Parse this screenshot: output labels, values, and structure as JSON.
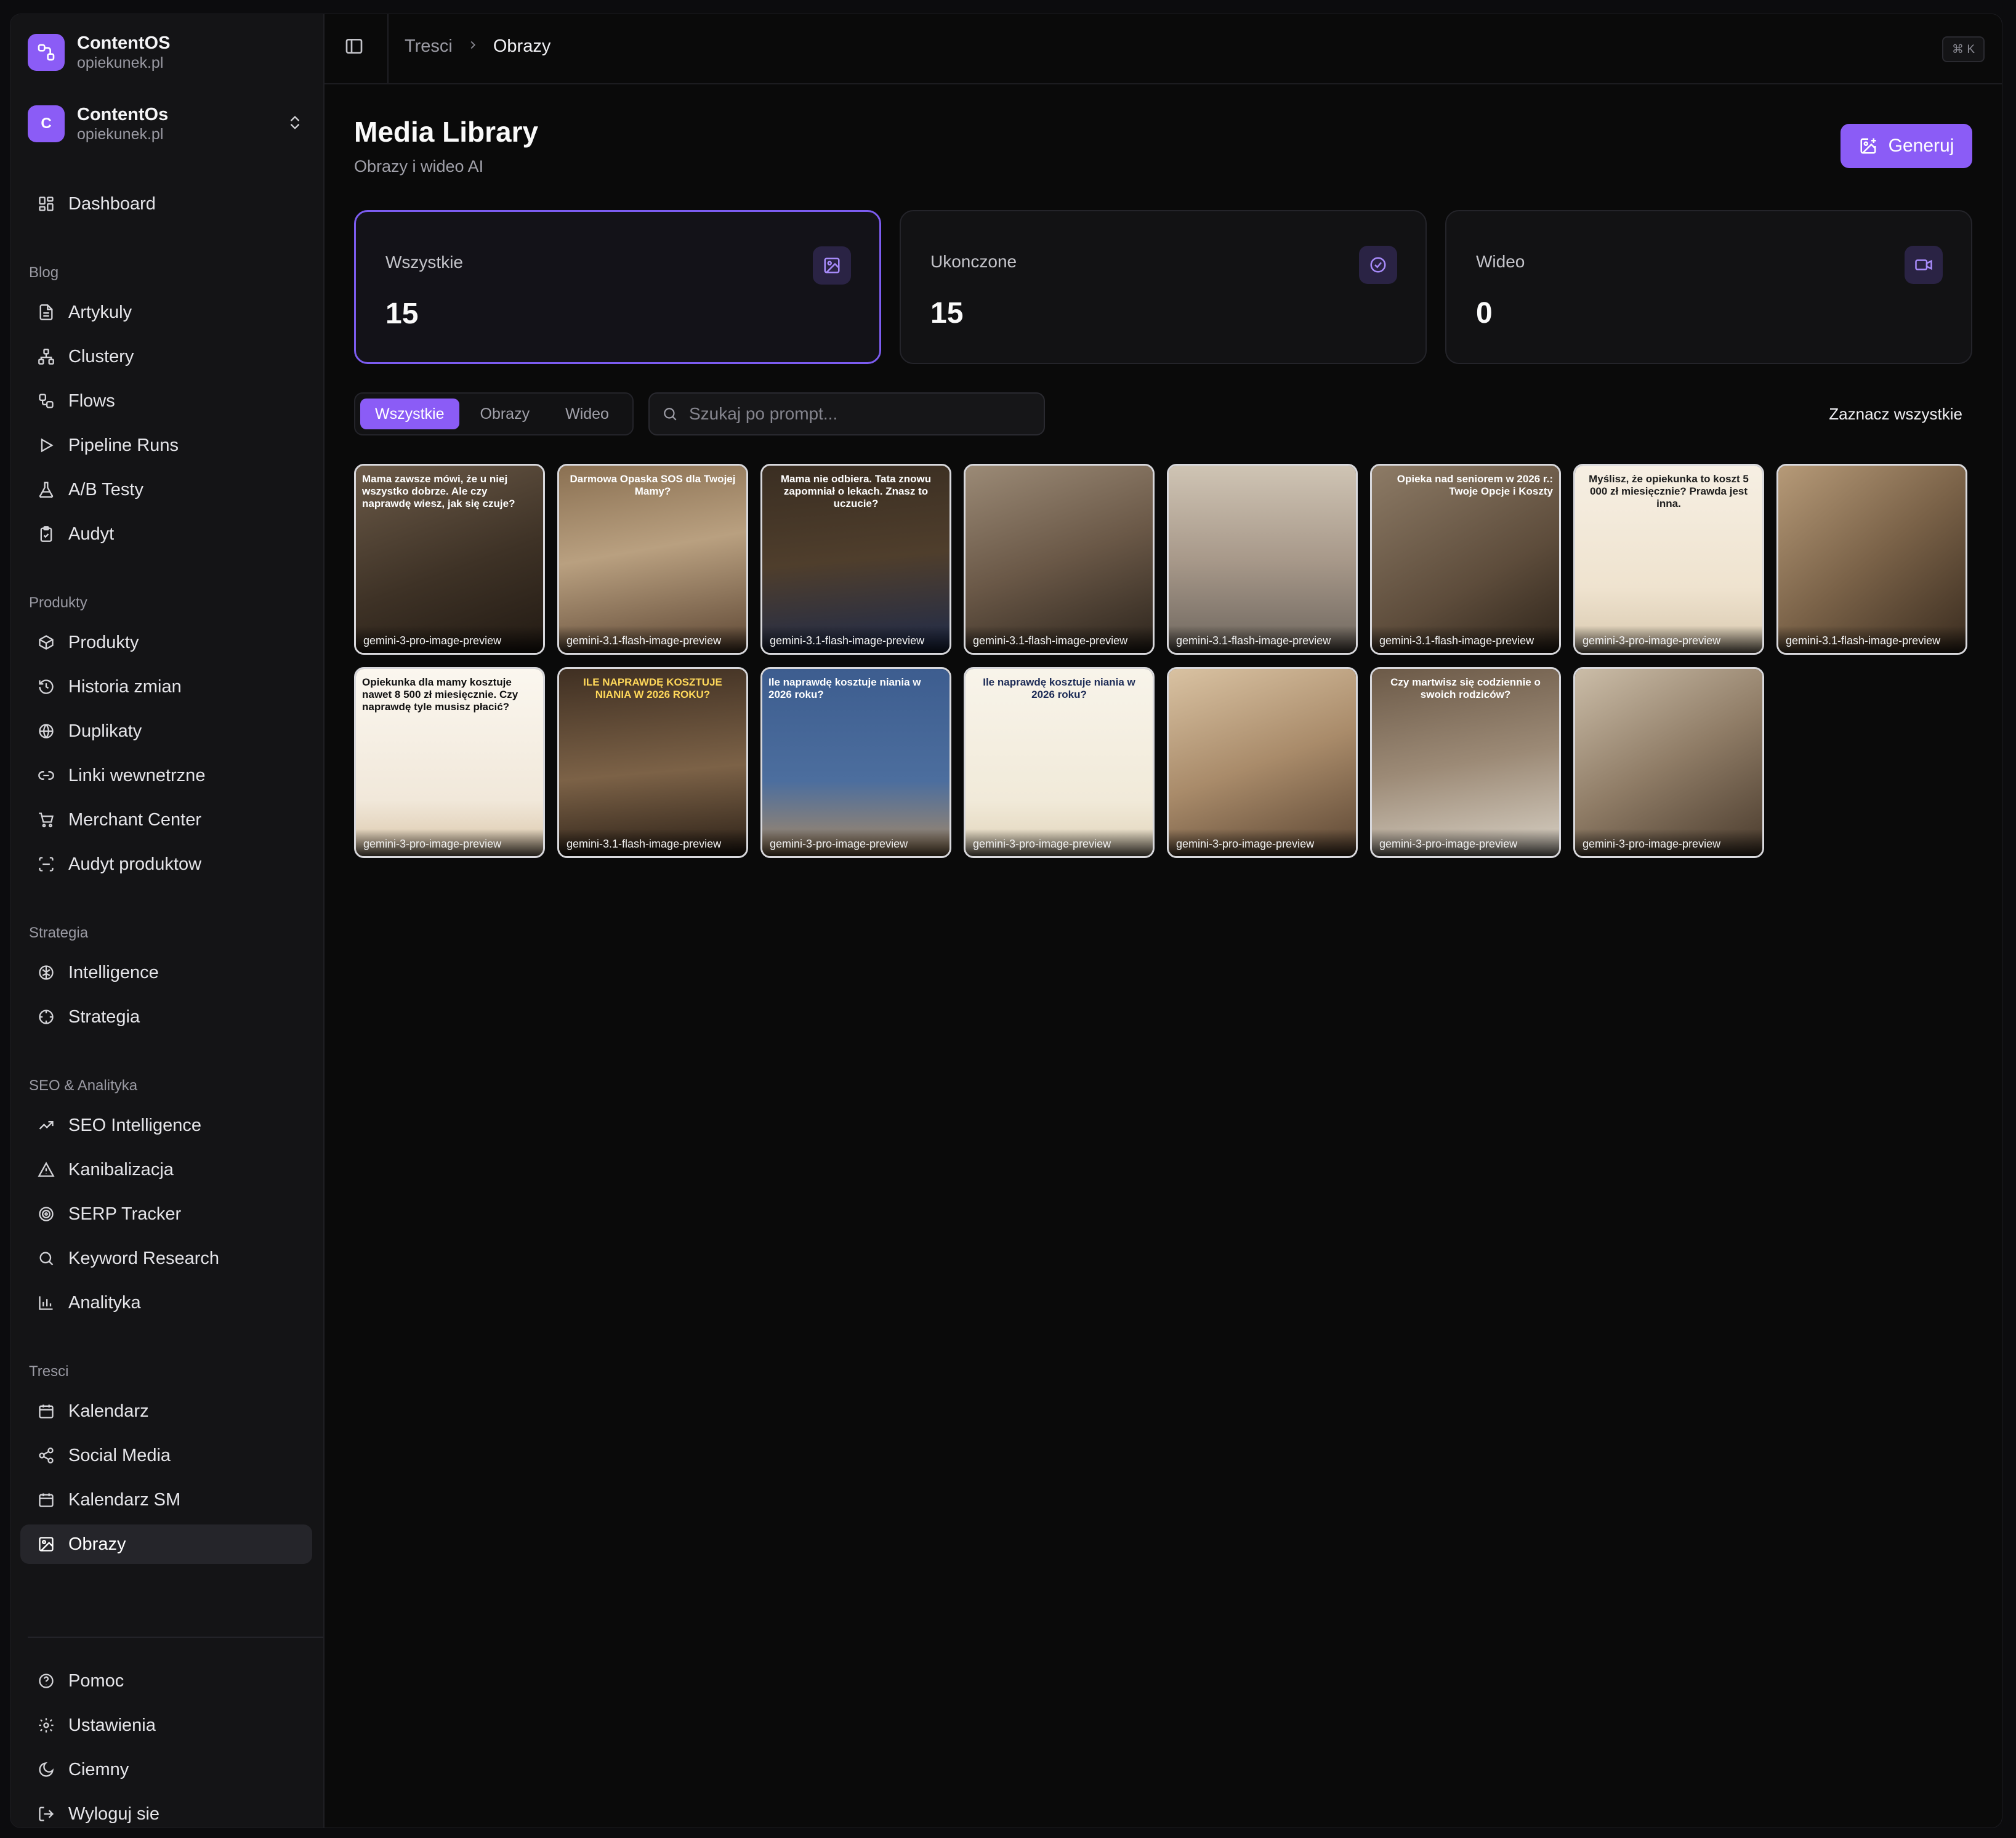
{
  "brand": {
    "name": "ContentOS",
    "domain": "opiekunek.pl",
    "icon": "logo-icon"
  },
  "workspace": {
    "initial": "C",
    "name": "ContentOs",
    "domain": "opiekunek.pl"
  },
  "nav": {
    "dashboard": "Dashboard",
    "blog_label": "Blog",
    "blog": [
      "Artykuly",
      "Clustery",
      "Flows",
      "Pipeline Runs",
      "A/B Testy",
      "Audyt"
    ],
    "produkty_label": "Produkty",
    "produkty": [
      "Produkty",
      "Historia zmian",
      "Duplikaty",
      "Linki wewnetrzne",
      "Merchant Center",
      "Audyt produktow"
    ],
    "strategia_label": "Strategia",
    "strategia": [
      "Intelligence",
      "Strategia"
    ],
    "seo_label": "SEO & Analityka",
    "seo": [
      "SEO Intelligence",
      "Kanibalizacja",
      "SERP Tracker",
      "Keyword Research",
      "Analityka"
    ],
    "tresci_label": "Tresci",
    "tresci": [
      "Kalendarz",
      "Social Media",
      "Kalendarz SM",
      "Obrazy"
    ],
    "footer": [
      "Pomoc",
      "Ustawienia",
      "Ciemny",
      "Wyloguj sie"
    ]
  },
  "topbar": {
    "crumb_parent": "Tresci",
    "crumb_current": "Obrazy",
    "shortcut": "⌘ K"
  },
  "page": {
    "title": "Media Library",
    "subtitle": "Obrazy i wideo AI",
    "generate_label": "Generuj"
  },
  "stats": [
    {
      "label": "Wszystkie",
      "value": "15",
      "icon": "image-icon"
    },
    {
      "label": "Ukonczone",
      "value": "15",
      "icon": "check-circle-icon"
    },
    {
      "label": "Wideo",
      "value": "0",
      "icon": "video-icon"
    }
  ],
  "filters": {
    "tabs": [
      "Wszystkie",
      "Obrazy",
      "Wideo"
    ],
    "active_tab": "Wszystkie",
    "search_placeholder": "Szukaj po prompt...",
    "select_all": "Zaznacz wszystkie"
  },
  "media": [
    {
      "caption": "gemini-3-pro-image-preview",
      "headline": "Mama zawsze mówi, że u niej wszystko dobrze. Ale czy naprawdę wiesz, jak się czuje?"
    },
    {
      "caption": "gemini-3.1-flash-image-preview",
      "headline": "Darmowa Opaska SOS dla Twojej Mamy?"
    },
    {
      "caption": "gemini-3.1-flash-image-preview",
      "headline": "Mama nie odbiera. Tata znowu zapomniał o lekach. Znasz to uczucie?"
    },
    {
      "caption": "gemini-3.1-flash-image-preview",
      "headline": ""
    },
    {
      "caption": "gemini-3.1-flash-image-preview",
      "headline": ""
    },
    {
      "caption": "gemini-3.1-flash-image-preview",
      "headline": "Opieka nad seniorem w 2026 r.: Twoje Opcje i Koszty"
    },
    {
      "caption": "gemini-3-pro-image-preview",
      "headline": "Myślisz, że opiekunka to koszt 5 000 zł miesięcznie? Prawda jest inna."
    },
    {
      "caption": "gemini-3.1-flash-image-preview",
      "headline": ""
    },
    {
      "caption": "gemini-3-pro-image-preview",
      "headline": "Opiekunka dla mamy kosztuje nawet 8 500 zł miesięcznie. Czy naprawdę tyle musisz płacić?"
    },
    {
      "caption": "gemini-3.1-flash-image-preview",
      "headline": "ILE NAPRAWDĘ KOSZTUJE NIANIA W 2026 ROKU?"
    },
    {
      "caption": "gemini-3-pro-image-preview",
      "headline": "Ile naprawdę kosztuje niania w 2026 roku?"
    },
    {
      "caption": "gemini-3-pro-image-preview",
      "headline": "Ile naprawdę kosztuje niania w 2026 roku?"
    },
    {
      "caption": "gemini-3-pro-image-preview",
      "headline": ""
    },
    {
      "caption": "gemini-3-pro-image-preview",
      "headline": "Czy martwisz się codziennie o swoich rodziców?"
    },
    {
      "caption": "gemini-3-pro-image-preview",
      "headline": ""
    }
  ],
  "colors": {
    "accent": "#8b5cf6",
    "background": "#0a0a0a",
    "sidebar": "#141416"
  }
}
